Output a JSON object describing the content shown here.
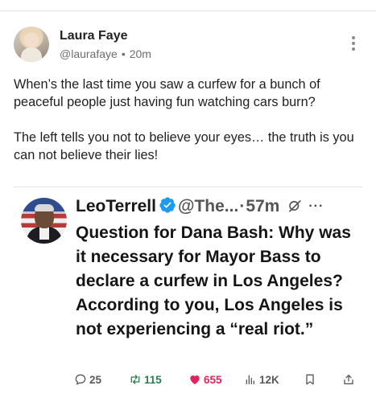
{
  "post": {
    "author_name": "Laura Faye",
    "handle": "@laurafaye",
    "separator": "•",
    "time": "20m",
    "paragraphs": [
      "When’s the last time you saw a curfew for a bunch of peaceful people just having fun watching cars burn?",
      "The left tells you not to believe your eyes… the truth is you can not believe their lies!"
    ]
  },
  "embed": {
    "name": "LeoTerrell",
    "handle": "@The...",
    "separator": "·",
    "time": "57m",
    "more": "···",
    "text": "Question for Dana Bash: Why was it necessary for Mayor Bass to declare a curfew in Los Angeles? According to you, Los Angeles is not experiencing a “real riot.”",
    "stats": {
      "replies": "25",
      "reposts": "115",
      "likes": "655",
      "views": "12K"
    }
  },
  "icons": {
    "more": "vertical-dots-icon",
    "verified": "verified-badge-icon",
    "grok": "grok-icon",
    "reply": "reply-icon",
    "repost": "repost-icon",
    "like": "heart-icon",
    "views": "views-chart-icon",
    "bookmark": "bookmark-icon",
    "share": "share-icon"
  },
  "colors": {
    "verified": "#1d9bf0",
    "repost": "#2e7d4f",
    "like": "#e0245e",
    "muted": "#6e6e6e"
  }
}
